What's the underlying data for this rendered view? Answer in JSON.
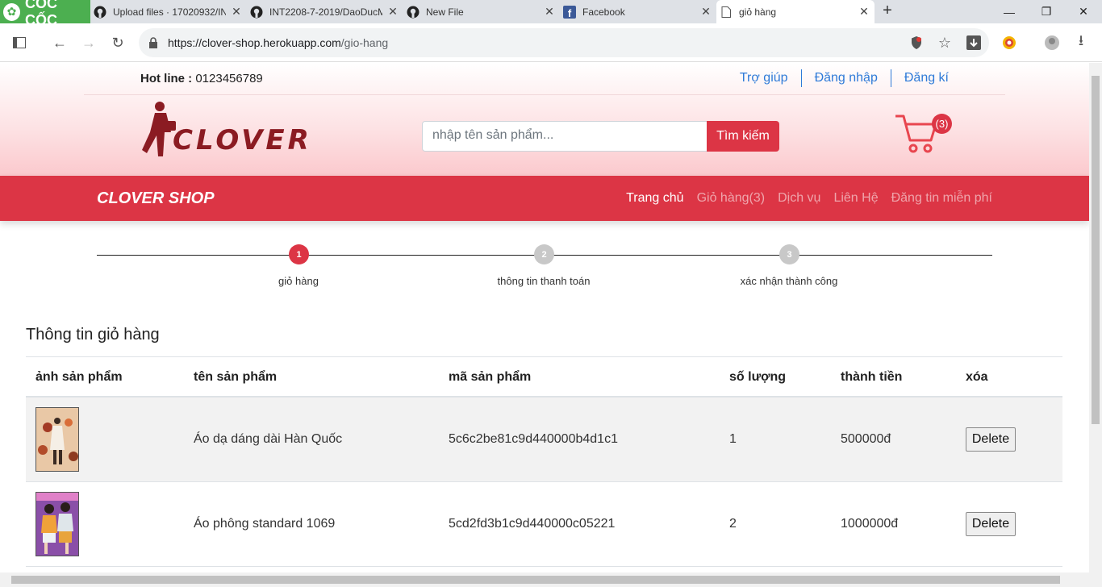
{
  "browser": {
    "brand": "CỐC CỐC",
    "tabs": [
      {
        "title": "Upload files · 17020932/IN",
        "icon": "github-icon"
      },
      {
        "title": "INT2208-7-2019/DaoDucM",
        "icon": "github-icon"
      },
      {
        "title": "New File",
        "icon": "github-icon"
      },
      {
        "title": "Facebook",
        "icon": "facebook-icon"
      },
      {
        "title": "giỏ hàng",
        "icon": "page-icon",
        "active": true
      }
    ],
    "url_host": "https://clover-shop.herokuapp.com",
    "url_path": "/gio-hang"
  },
  "header": {
    "hotline_label": "Hot line :",
    "hotline_number": " 0123456789",
    "links": [
      "Trợ giúp",
      "Đăng nhập",
      "Đăng kí"
    ],
    "logo_text": "CLOVER",
    "search_placeholder": "nhập tên sản phẩm...",
    "search_button": "Tìm kiếm",
    "cart_count": "(3)"
  },
  "navbar": {
    "brand": "CLOVER SHOP",
    "links": [
      "Trang chủ",
      "Giỏ hàng(3)",
      "Dịch vụ",
      "Liên Hệ",
      "Đăng tin miễn phí"
    ]
  },
  "steps": [
    {
      "num": "1",
      "label": "giỏ hàng"
    },
    {
      "num": "2",
      "label": "thông tin thanh toán"
    },
    {
      "num": "3",
      "label": "xác nhận thành công"
    }
  ],
  "cart": {
    "title": "Thông tin giỏ hàng",
    "columns": [
      "ảnh sản phẩm",
      "tên sản phẩm",
      "mã sản phẩm",
      "số lượng",
      "thành tiền",
      "xóa"
    ],
    "rows": [
      {
        "name": "Áo dạ dáng dài Hàn Quốc",
        "code": "5c6c2be81c9d440000b4d1c1",
        "qty": "1",
        "total": "500000đ",
        "delete": "Delete"
      },
      {
        "name": "Áo phông standard 1069",
        "code": "5cd2fd3b1c9d440000c05221",
        "qty": "2",
        "total": "1000000đ",
        "delete": "Delete"
      }
    ]
  },
  "colors": {
    "accent": "#dc3545",
    "link": "#2f7bd8",
    "logo": "#8b1b22"
  }
}
